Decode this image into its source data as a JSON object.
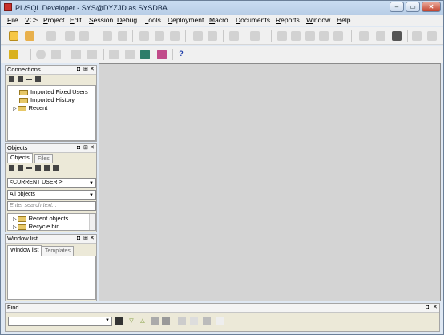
{
  "window": {
    "title": "PL/SQL Developer - SYS@DYZJD as SYSDBA",
    "buttons": [
      "–",
      "▭",
      "✕"
    ]
  },
  "menu": [
    "File",
    "VCS",
    "Project",
    "Edit",
    "Session",
    "Debug",
    "Tools",
    "Deployment",
    "Macro",
    "Documents",
    "Reports",
    "Window",
    "Help"
  ],
  "toolbar2": {
    "help": "?"
  },
  "connections": {
    "title": "Connections",
    "controls": [
      "◘",
      "⊞",
      "✕"
    ],
    "items": [
      "Imported Fixed Users",
      "Imported History",
      "Recent"
    ]
  },
  "objects": {
    "title": "Objects",
    "controls": [
      "◘",
      "⊞",
      "✕"
    ],
    "tabs": [
      "Objects",
      "Files"
    ],
    "user_combo": "<CURRENT USER >",
    "filter_combo": "All objects",
    "search_placeholder": "Enter search text...",
    "items": [
      "Recent objects",
      "Recycle bin"
    ]
  },
  "window_list": {
    "title": "Window list",
    "controls": [
      "◘",
      "⊞",
      "✕"
    ],
    "tabs": [
      "Window list",
      "Templates"
    ]
  },
  "find": {
    "title": "Find",
    "controls": [
      "◘",
      "✕"
    ]
  }
}
